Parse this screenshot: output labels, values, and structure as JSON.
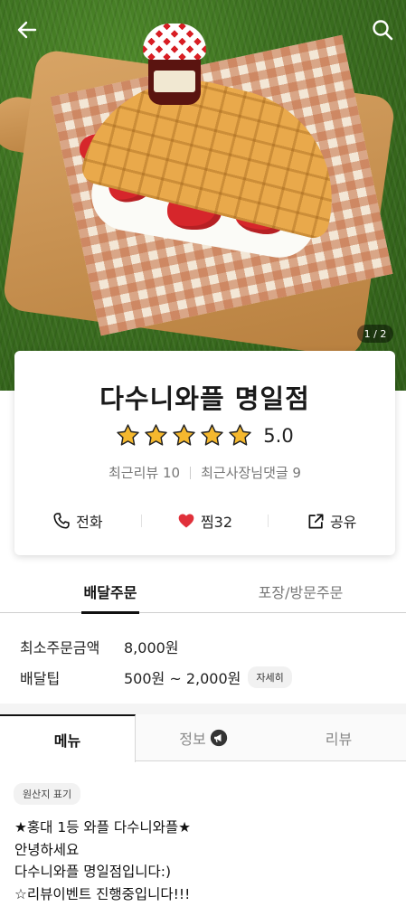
{
  "hero": {
    "page_indicator": "1 / 2",
    "back_icon": "back-arrow-icon",
    "search_icon": "search-icon"
  },
  "store": {
    "name": "다수니와플 명일점",
    "rating": "5.0",
    "stars": 5,
    "star_color": "#F5B82E",
    "recent_reviews": "최근리뷰 10",
    "owner_replies": "최근사장님댓글 9"
  },
  "actions": {
    "call": "전화",
    "like": "찜32",
    "share": "공유",
    "heart_color": "#E0303A"
  },
  "order_tabs": {
    "delivery": "배달주문",
    "pickup": "포장/방문주문"
  },
  "order_info": {
    "min_order_label": "최소주문금액",
    "min_order_value": "8,000원",
    "tip_label": "배달팁",
    "tip_value": "500원 ~ 2,000원",
    "detail_button": "자세히"
  },
  "content_tabs": {
    "menu": "메뉴",
    "info": "정보",
    "review": "리뷰"
  },
  "origin_chip": "원산지 표기",
  "intro": {
    "line1": "★홍대 1등 와플 다수니와플★",
    "line2": "안녕하세요",
    "line3": "다수니와플 명일점입니다:)",
    "line4": "☆리뷰이벤트 진행중입니다!!!"
  }
}
